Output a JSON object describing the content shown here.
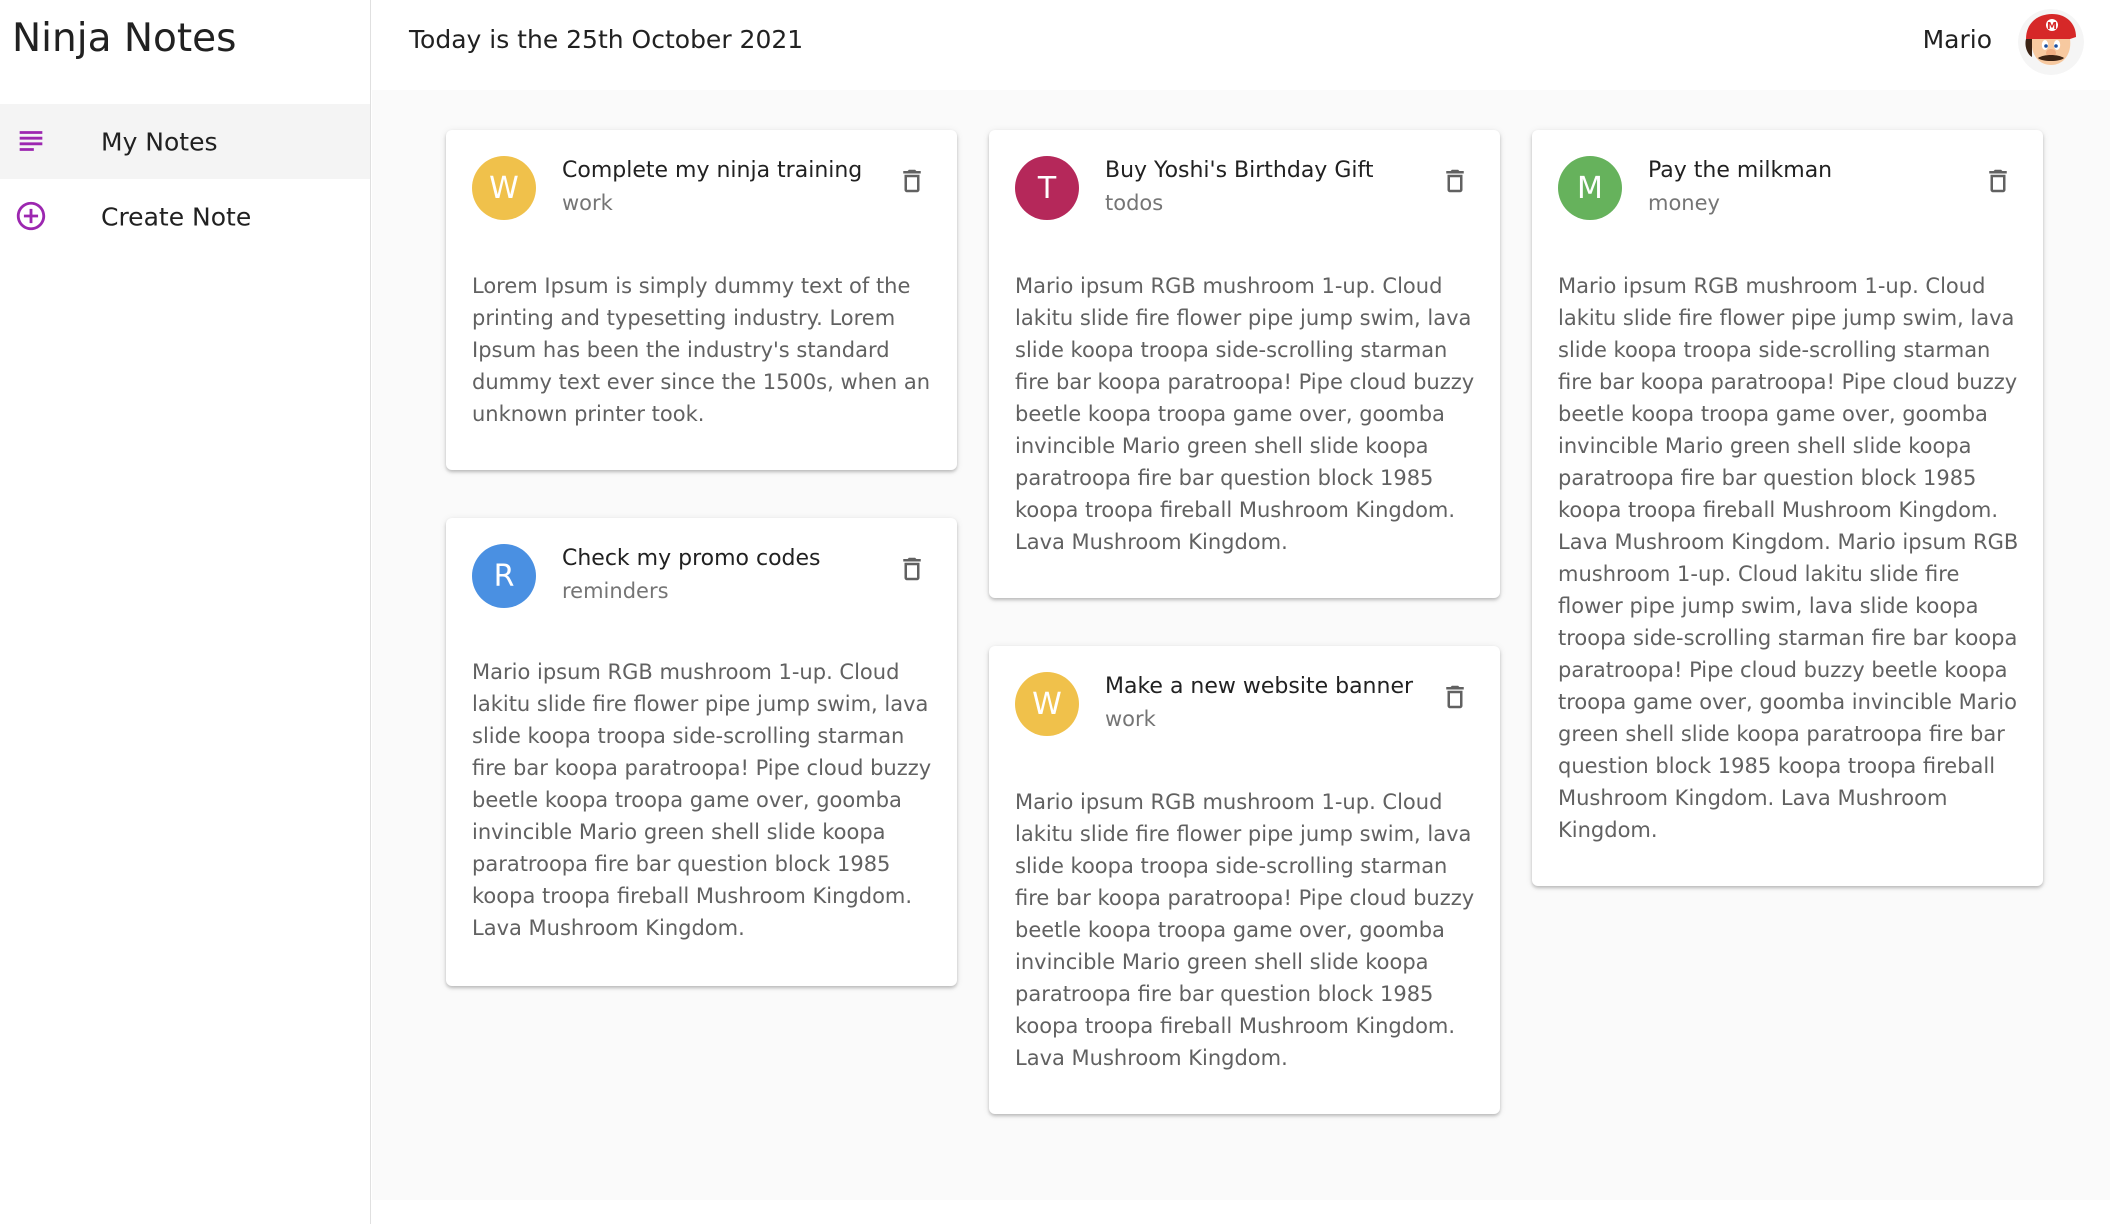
{
  "app": {
    "title": "Ninja Notes"
  },
  "sidebar": {
    "items": [
      {
        "label": "My Notes",
        "icon": "subject-icon",
        "active": true
      },
      {
        "label": "Create Note",
        "icon": "add-circle-outline-icon",
        "active": false
      }
    ],
    "accent": "#9c27b0"
  },
  "header": {
    "date_text": "Today is the 25th October 2021",
    "user_name": "Mario"
  },
  "notes": [
    {
      "initial": "W",
      "avatar_color": "#f0c14b",
      "title": "Complete my ninja training",
      "category": "work",
      "body": "Lorem Ipsum is simply dummy text of the printing and typesetting industry. Lorem Ipsum has been the industry's standard dummy text ever since the 1500s, when an unknown printer took."
    },
    {
      "initial": "R",
      "avatar_color": "#4a90e2",
      "title": "Check my promo codes",
      "category": "reminders",
      "body": "Mario ipsum RGB mushroom 1-up. Cloud lakitu slide fire flower pipe jump swim, lava slide koopa troopa side-scrolling starman fire bar koopa paratroopa! Pipe cloud buzzy beetle koopa troopa game over, goomba invincible Mario green shell slide koopa paratroopa fire bar question block 1985 koopa troopa fireball Mushroom Kingdom. Lava Mushroom Kingdom."
    },
    {
      "initial": "T",
      "avatar_color": "#b5285a",
      "title": "Buy Yoshi's Birthday Gift",
      "category": "todos",
      "body": "Mario ipsum RGB mushroom 1-up. Cloud lakitu slide fire flower pipe jump swim, lava slide koopa troopa side-scrolling starman fire bar koopa paratroopa! Pipe cloud buzzy beetle koopa troopa game over, goomba invincible Mario green shell slide koopa paratroopa fire bar question block 1985 koopa troopa fireball Mushroom Kingdom. Lava Mushroom Kingdom."
    },
    {
      "initial": "W",
      "avatar_color": "#f0c14b",
      "title": "Make a new website banner",
      "category": "work",
      "body": "Mario ipsum RGB mushroom 1-up. Cloud lakitu slide fire flower pipe jump swim, lava slide koopa troopa side-scrolling starman fire bar koopa paratroopa! Pipe cloud buzzy beetle koopa troopa game over, goomba invincible Mario green shell slide koopa paratroopa fire bar question block 1985 koopa troopa fireball Mushroom Kingdom. Lava Mushroom Kingdom."
    },
    {
      "initial": "M",
      "avatar_color": "#66b25c",
      "title": "Pay the milkman",
      "category": "money",
      "body": "Mario ipsum RGB mushroom 1-up. Cloud lakitu slide fire flower pipe jump swim, lava slide koopa troopa side-scrolling starman fire bar koopa paratroopa! Pipe cloud buzzy beetle koopa troopa game over, goomba invincible Mario green shell slide koopa paratroopa fire bar question block 1985 koopa troopa fireball Mushroom Kingdom. Lava Mushroom Kingdom. Mario ipsum RGB mushroom 1-up. Cloud lakitu slide fire flower pipe jump swim, lava slide koopa troopa side-scrolling starman fire bar koopa paratroopa! Pipe cloud buzzy beetle koopa troopa game over, goomba invincible Mario green shell slide koopa paratroopa fire bar question block 1985 koopa troopa fireball Mushroom Kingdom. Lava Mushroom Kingdom."
    }
  ],
  "icons": {
    "delete": "delete-icon",
    "avatar": "user-avatar"
  }
}
